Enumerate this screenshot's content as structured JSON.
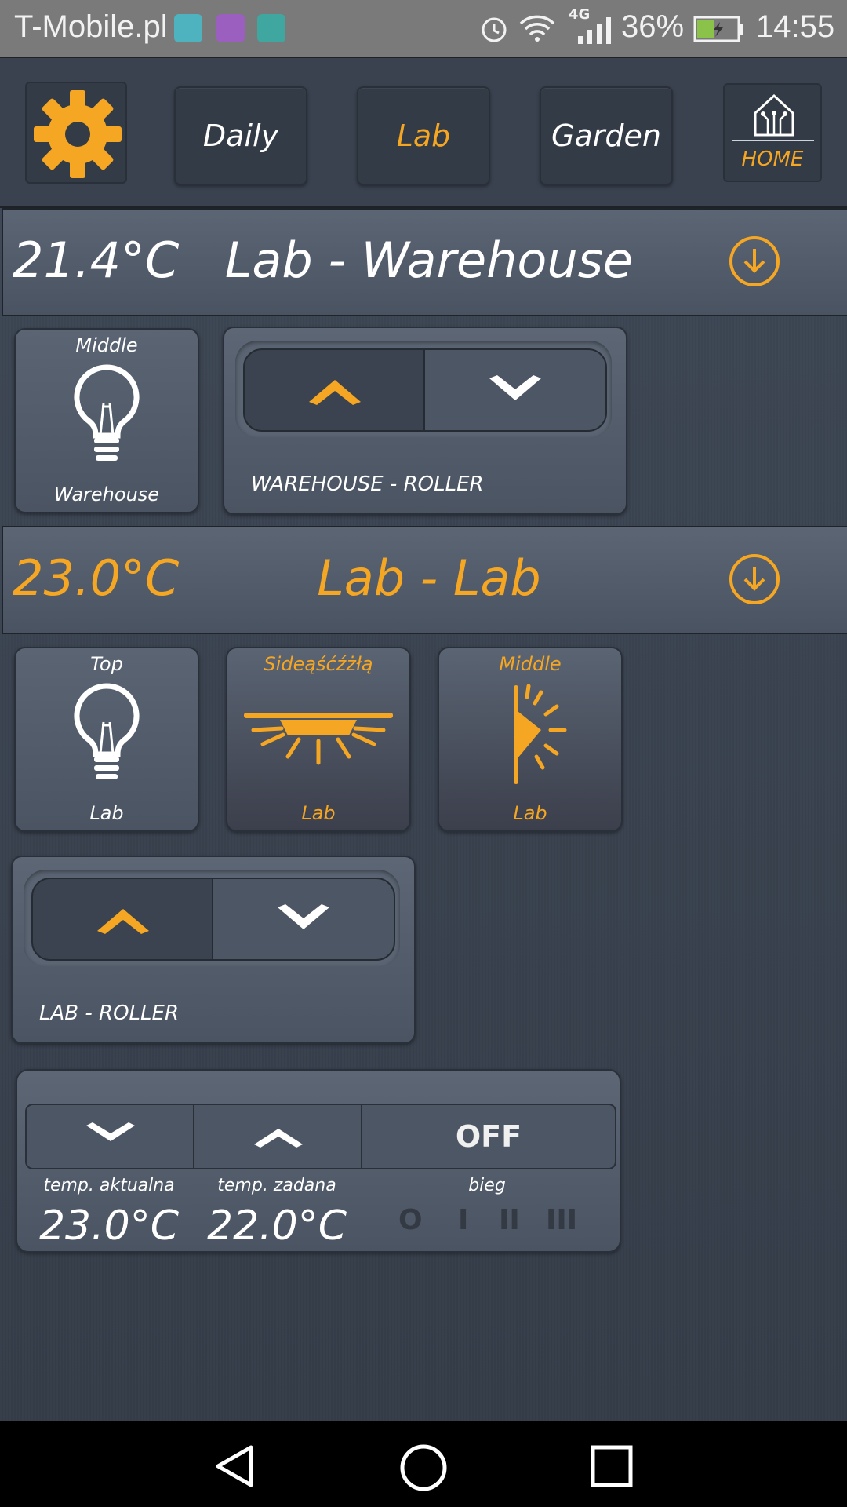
{
  "status_bar": {
    "carrier": "T-Mobile.pl",
    "battery": "36%",
    "time": "14:55",
    "network": "4G"
  },
  "nav": {
    "settings_icon": "gear-icon",
    "tabs": [
      {
        "label": "Daily",
        "active": false
      },
      {
        "label": "Lab",
        "active": true
      },
      {
        "label": "Garden",
        "active": false
      }
    ],
    "home_label": "HOME"
  },
  "sections": [
    {
      "temperature": "21.4°C",
      "title": "Lab - Warehouse",
      "active": false,
      "tiles": [
        {
          "top": "Middle",
          "bottom": "Warehouse",
          "icon": "bulb-icon",
          "on": false
        }
      ],
      "roller": {
        "label": "WAREHOUSE - ROLLER"
      }
    },
    {
      "temperature": "23.0°C",
      "title": "Lab - Lab",
      "active": true,
      "tiles": [
        {
          "top": "Top",
          "bottom": "Lab",
          "icon": "bulb-icon",
          "on": false
        },
        {
          "top": "Sideąśćźżłą",
          "bottom": "Lab",
          "icon": "ceiling-lamp-icon",
          "on": true
        },
        {
          "top": "Middle",
          "bottom": "Lab",
          "icon": "wall-lamp-icon",
          "on": true
        }
      ],
      "roller": {
        "label": "LAB - ROLLER"
      }
    }
  ],
  "thermostat": {
    "mode_label": "OFF",
    "current_label": "temp. aktualna",
    "current_value": "23.0°C",
    "target_label": "temp. zadana",
    "target_value": "22.0°C",
    "gear_label": "bieg",
    "gears": [
      "O",
      "I",
      "II",
      "III"
    ]
  },
  "colors": {
    "accent": "#f5a623",
    "background": "#3a4350"
  }
}
